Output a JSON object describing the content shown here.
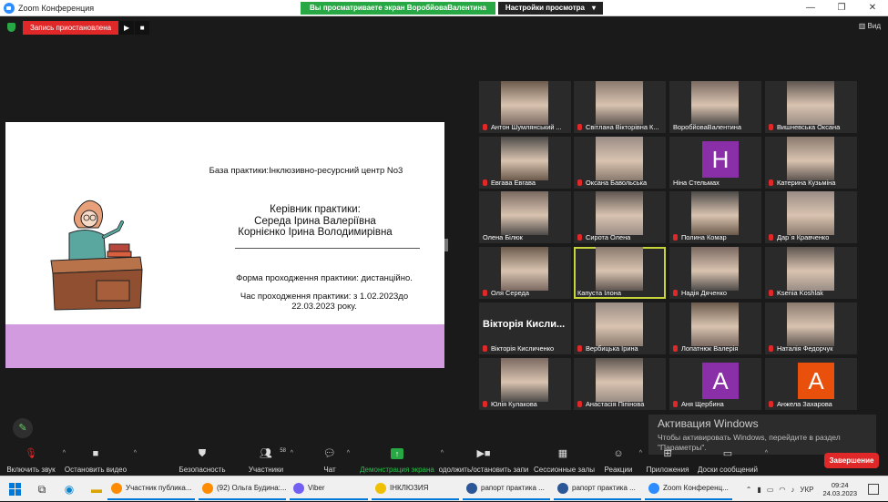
{
  "titlebar": {
    "app_title": "Zoom Конференция",
    "share_banner": "Вы просматриваете экран ВоробйоваВалентина",
    "view_settings": "Настройки просмотра",
    "view_settings_caret": "▾",
    "minimize": "—",
    "maximize": "❐",
    "close": "✕"
  },
  "recording": {
    "status": "Запись приостановлена",
    "play_icon": "play-icon",
    "stop_icon": "stop-icon"
  },
  "view_button": "Вид",
  "slide": {
    "base": "База практики:Інклюзивно-ресурсний центр No3",
    "supervisors_title": "Керівник практики:",
    "supervisor_1": "Середа Ірина Валеріївна",
    "supervisor_2": "Корнієнко Ірина Володимирівна",
    "form": "Форма проходження практики: дистанційно.",
    "period_1": "Час проходження практики: з 1.02.2023до",
    "period_2": "22.03.2023 року.",
    "accent_color": "#d29be0"
  },
  "participants": [
    {
      "name": "Антон Шумлянський ...",
      "muted": true
    },
    {
      "name": "Світлана Вікторівна К...",
      "muted": true
    },
    {
      "name": "ВоробйоваВалентина",
      "muted": false
    },
    {
      "name": "Вишневська Оксана",
      "muted": true
    },
    {
      "name": "Евгава Евгава",
      "muted": true
    },
    {
      "name": "Оксана Бавольська",
      "muted": true
    },
    {
      "name": "Ніна Стельмах",
      "muted": false,
      "letter": "Н",
      "color": "#8b2fa8"
    },
    {
      "name": "Катерина Кузьміна",
      "muted": true
    },
    {
      "name": "Олена Бiлюк",
      "muted": false
    },
    {
      "name": "Сирота Олена",
      "muted": true
    },
    {
      "name": "Полина Комар",
      "muted": true
    },
    {
      "name": "Дар`я Кравченко",
      "muted": true
    },
    {
      "name": "Оля Середа",
      "muted": true
    },
    {
      "name": "Капуста Ілона",
      "muted": false,
      "active": true
    },
    {
      "name": "Надія Дяченко",
      "muted": true
    },
    {
      "name": "Ksenia Koshlak",
      "muted": true
    },
    {
      "name": "Вікторія Кисличенко",
      "muted": true,
      "big_name": "Вікторія Кисли..."
    },
    {
      "name": "Вербицька Ірина",
      "muted": true
    },
    {
      "name": "Лопатнюк Валерія",
      "muted": true
    },
    {
      "name": "Наталія Федорчук",
      "muted": true
    },
    {
      "name": "Юлія Кулакова",
      "muted": true
    },
    {
      "name": "Анастасія Піпінова",
      "muted": true
    },
    {
      "name": "Аня Щербина",
      "muted": true,
      "letter": "А",
      "color": "#8b2fa8"
    },
    {
      "name": "Анжела Захарова",
      "muted": true,
      "letter": "А",
      "color": "#e8500c"
    }
  ],
  "activation": {
    "title": "Активация Windows",
    "subtitle": "Чтобы активировать Windows, перейдите в раздел \"Параметры\"."
  },
  "toolbar": {
    "audio": "Включить звук",
    "video": "Остановить видео",
    "security": "Безопасность",
    "participants": "Участники",
    "participants_count": "58",
    "chat": "Чат",
    "share": "Демонстрация экрана",
    "record": "одолжить/остановить запи",
    "breakout": "Сессионные залы",
    "reactions": "Реакции",
    "apps": "Приложения",
    "whiteboards": "Доски сообщений",
    "end": "Завершение"
  },
  "taskbar": {
    "tasks": [
      {
        "label": "Участник публика...",
        "color": "#ff8c00"
      },
      {
        "label": "(92) Ольга Будина:...",
        "color": "#ff8c00"
      },
      {
        "label": "Viber",
        "color": "#7360f2"
      },
      {
        "label": "ІНКЛЮЗИЯ",
        "color": "#f0c000"
      },
      {
        "label": "рапорт практика ...",
        "color": "#2b5797"
      },
      {
        "label": "рапорт практика ...",
        "color": "#2b5797"
      },
      {
        "label": "Zoom Конференц...",
        "color": "#2d8cff"
      }
    ],
    "lang": "УКР",
    "time": "09:24",
    "date": "24.03.2023"
  }
}
